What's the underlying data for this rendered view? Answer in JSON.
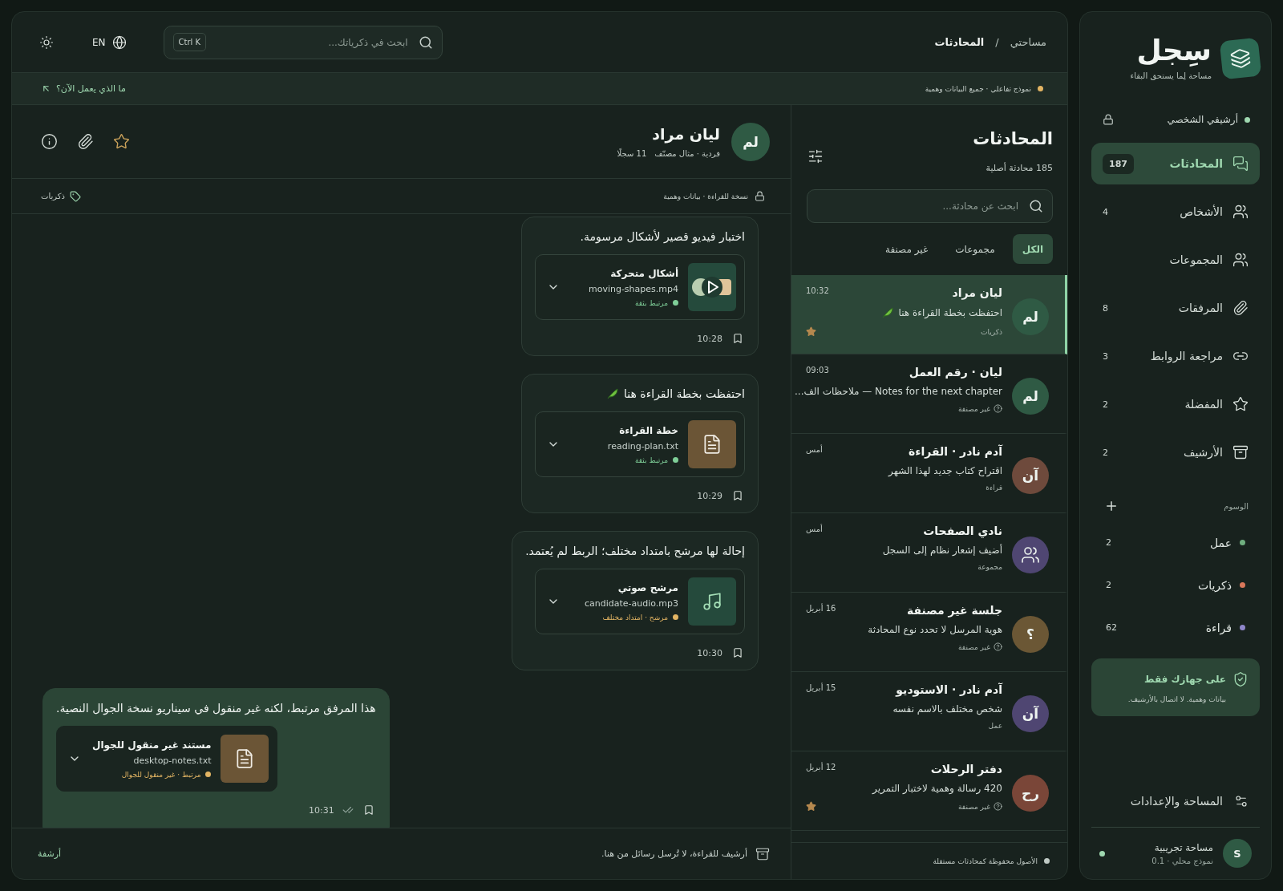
{
  "sidebar": {
    "brand": {
      "name": "سِجل",
      "tagline": "مساحة لِما يستحق البقاء"
    },
    "archive": {
      "label": "أرشيفي الشخصي",
      "locked": true
    },
    "nav": [
      {
        "kind": "chats",
        "label": "المحادثات",
        "count": "187",
        "selected": true
      },
      {
        "kind": "people",
        "label": "الأشخاص",
        "count": "4",
        "selected": false
      },
      {
        "kind": "groups",
        "label": "المجموعات",
        "selected": false
      },
      {
        "kind": "attachments",
        "label": "المرفقات",
        "count": "8",
        "selected": false
      },
      {
        "kind": "links",
        "label": "مراجعة الروابط",
        "count": "3",
        "selected": false
      },
      {
        "kind": "favorites",
        "label": "المفضلة",
        "count": "2",
        "selected": false
      },
      {
        "kind": "archive",
        "label": "الأرشيف",
        "count": "2",
        "selected": false
      }
    ],
    "tags_heading": "الوسوم",
    "tags": [
      {
        "label": "عمل",
        "count": "2",
        "color": "#6fae7f"
      },
      {
        "label": "ذكريات",
        "count": "2",
        "color": "#d9775a"
      },
      {
        "label": "قراءة",
        "count": "62",
        "color": "#8e86c9"
      }
    ],
    "notice": {
      "title": "على جهازك فقط",
      "body": "بيانات وهمية. لا اتصال بالأرشيف."
    },
    "settings": {
      "label": "المساحة والإعدادات"
    },
    "workspace": {
      "avatar": "S",
      "name": "مساحة تجريبية",
      "version": "نموذج محلي · 0.1",
      "online": true
    }
  },
  "topbar": {
    "breadcrumb": [
      "مساحتي",
      "/",
      "المحادثات"
    ],
    "search": {
      "placeholder": "ابحث في ذكرياتك...",
      "shortcut": "Ctrl K"
    },
    "language": "EN"
  },
  "banner": {
    "note": "نموذج تفاعلي · جميع البيانات وهمية",
    "link": "ما الذي يعمل الآن؟"
  },
  "conversations": {
    "title": "المحادثات",
    "subtitle": "185 محادثة أصلية",
    "search": {
      "placeholder": "ابحث عن محادثة..."
    },
    "filters": [
      {
        "label": "الكل",
        "selected": true
      },
      {
        "label": "مجموعات",
        "selected": false
      },
      {
        "label": "غير مصنفة",
        "selected": false
      }
    ],
    "items": [
      {
        "kind": "person",
        "initials": "لم",
        "color": "#2f5a44",
        "name": "ليان مراد",
        "time": "10:32",
        "preview": "احتفظت بخطة القراءة هنا",
        "leaf": true,
        "tag": "ذكريات",
        "uncategorized": false,
        "starred": true,
        "selected": true
      },
      {
        "kind": "person",
        "initials": "لم",
        "color": "#2f5a44",
        "name": "ليان · رقم العمل",
        "time": "09:03",
        "preview": "Notes for the next chapter — ملاحظات الف...",
        "leaf": false,
        "tag": "غير مصنفة",
        "uncategorized": true,
        "starred": false,
        "selected": false
      },
      {
        "kind": "person",
        "initials": "آن",
        "color": "#6e4a3c",
        "name": "آدم نادر · القراءة",
        "time": "أمس",
        "preview": "اقتراح كتاب جديد لهذا الشهر",
        "leaf": false,
        "tag": "قراءة",
        "uncategorized": false,
        "starred": false,
        "selected": false
      },
      {
        "kind": "group",
        "color": "#4f4672",
        "name": "نادي الصفحات",
        "time": "أمس",
        "preview": "أضيف إشعار نظام إلى السجل",
        "leaf": false,
        "tag": "مجموعة",
        "uncategorized": false,
        "starred": false,
        "selected": false
      },
      {
        "kind": "person",
        "initials": "؟",
        "color": "#6b5735",
        "name": "جلسة غير مصنفة",
        "time": "16 أبريل",
        "preview": "هوية المرسل لا تحدد نوع المحادثة",
        "leaf": false,
        "tag": "غير مصنفة",
        "uncategorized": true,
        "starred": false,
        "selected": false
      },
      {
        "kind": "person",
        "initials": "آن",
        "color": "#4f4672",
        "name": "آدم نادر · الاستوديو",
        "time": "15 أبريل",
        "preview": "شخص مختلف بالاسم نفسه",
        "leaf": false,
        "tag": "عمل",
        "uncategorized": false,
        "starred": false,
        "selected": false
      },
      {
        "kind": "person",
        "initials": "رح",
        "color": "#7a4638",
        "name": "دفتر الرحلات",
        "time": "12 أبريل",
        "preview": "420 رسالة وهمية لاختبار التمرير",
        "leaf": false,
        "tag": "غير مصنفة",
        "uncategorized": true,
        "starred": true,
        "selected": false
      }
    ],
    "footer": "الأصول محفوظة كمحادثات مستقلة"
  },
  "chat": {
    "header": {
      "initials": "لم",
      "name": "ليان مراد",
      "meta": "فردية · مثال مصنّف",
      "count": "11 سجلًا",
      "favorite": true
    },
    "info": {
      "readonly": "نسخة للقراءة · بيانات وهمية",
      "tag": "ذكريات"
    },
    "messages": [
      {
        "outgoing": false,
        "text": "اختبار فيديو قصير لأشكال مرسومة.",
        "leaf": false,
        "attachment": {
          "kind": "video",
          "title": "أشكال متحركة",
          "file": "moving-shapes.mp4",
          "status": {
            "label": "مرتبط بثقة",
            "color": "#7fcf98"
          }
        },
        "time": "10:28",
        "read": false
      },
      {
        "outgoing": false,
        "text": "احتفظت بخطة القراءة هنا",
        "leaf": true,
        "attachment": {
          "kind": "document",
          "title": "خطة القراءة",
          "file": "reading-plan.txt",
          "status": {
            "label": "مرتبط بثقة",
            "color": "#7fcf98"
          }
        },
        "time": "10:29",
        "read": false
      },
      {
        "outgoing": false,
        "text": "إحالة لها مرشح بامتداد مختلف؛ الربط لم يُعتمد.",
        "leaf": false,
        "attachment": {
          "kind": "audio",
          "title": "مرشح صوتي",
          "file": "candidate-audio.mp3",
          "status": {
            "label": "مرشح · امتداد مختلف",
            "color": "#e2b463"
          }
        },
        "time": "10:30",
        "read": false
      },
      {
        "outgoing": true,
        "text": "هذا المرفق مرتبط، لكنه غير منقول في سيناريو نسخة الجوال النصية.",
        "leaf": false,
        "attachment": {
          "kind": "document",
          "title": "مستند غير منقول للجوال",
          "file": "desktop-notes.txt",
          "status": {
            "label": "مرتبط · غير منقول للجوال",
            "color": "#e2b463"
          }
        },
        "time": "10:31",
        "read": true
      }
    ],
    "footer": {
      "note": "أرشيف للقراءة، لا تُرسل رسائل من هنا.",
      "action": "أرشفة"
    }
  }
}
